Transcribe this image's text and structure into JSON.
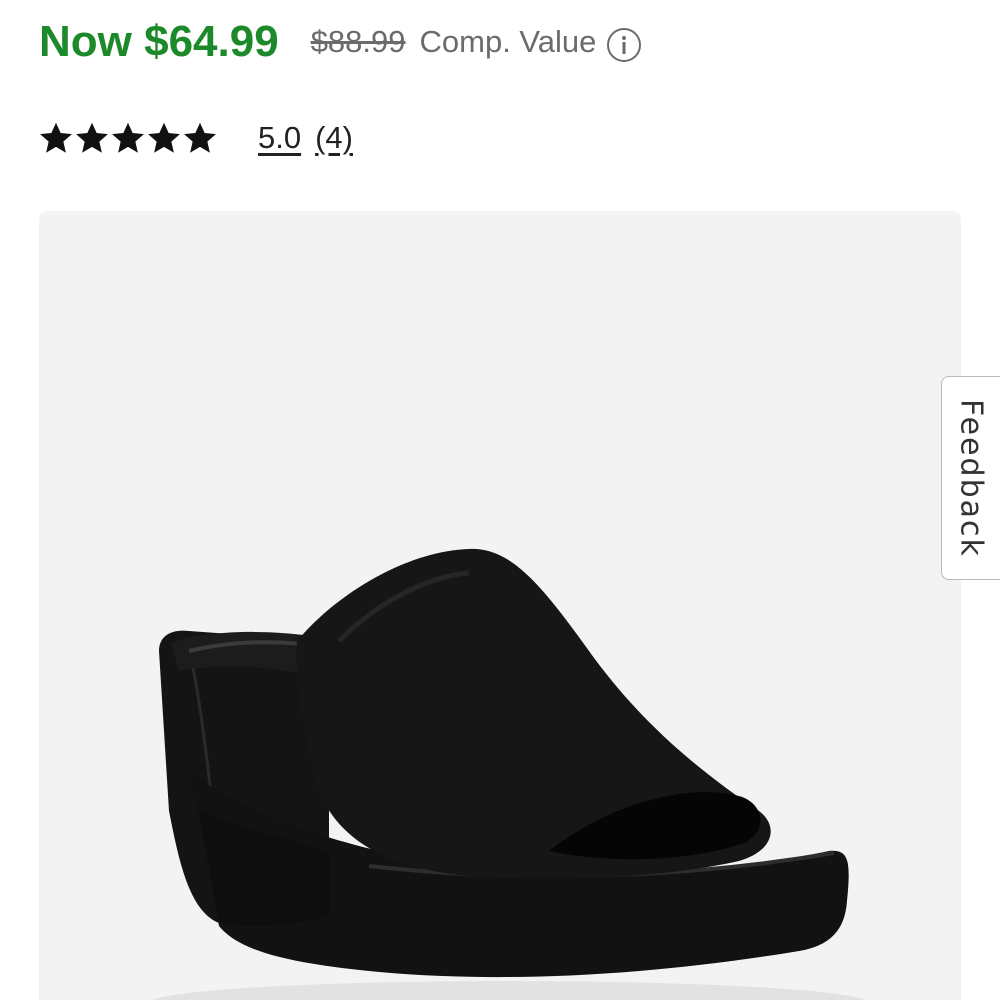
{
  "price": {
    "now": "Now $64.99",
    "was": "$88.99",
    "comp_label": "Comp. Value",
    "info_icon": "info-icon",
    "now_color": "#1c8a2a"
  },
  "rating": {
    "stars_filled": 5,
    "stars_total": 5,
    "value": "5.0",
    "count": "(4)",
    "star_icon": "star-icon"
  },
  "product": {
    "image_icon": "black-platform-slide-sandal",
    "card_background": "#f3f3f3"
  },
  "feedback": {
    "label": "Feedback"
  }
}
